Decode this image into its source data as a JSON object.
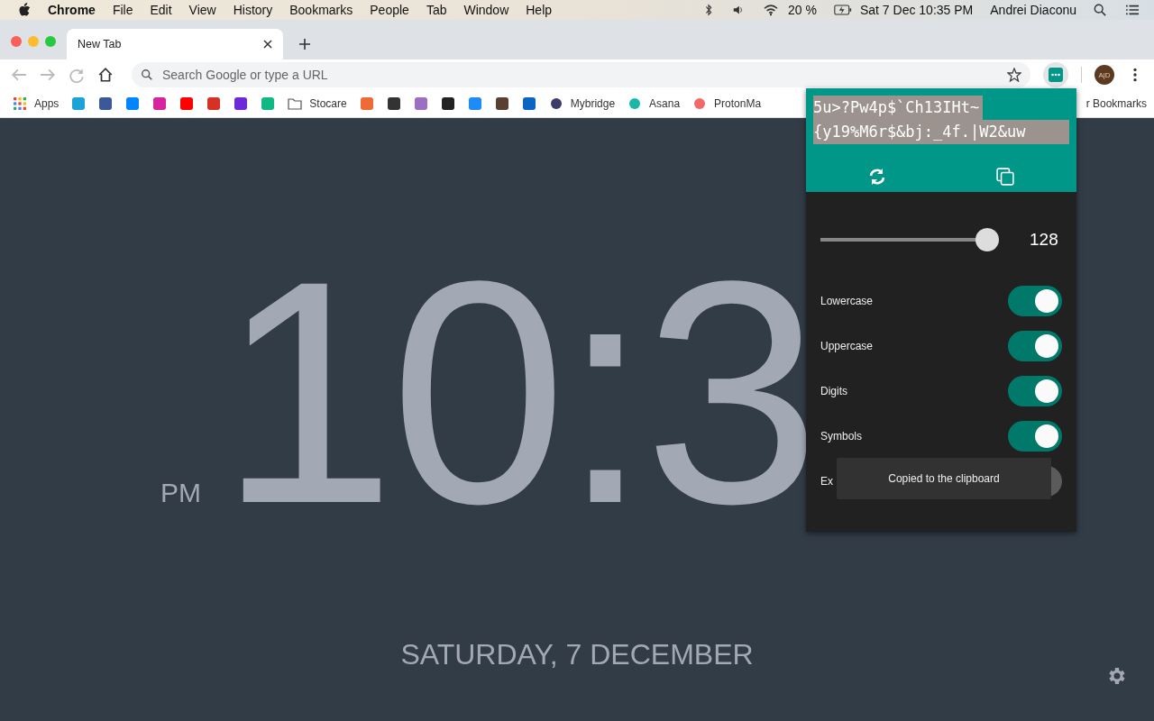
{
  "menubar": {
    "app": "Chrome",
    "items": [
      "File",
      "Edit",
      "View",
      "History",
      "Bookmarks",
      "People",
      "Tab",
      "Window",
      "Help"
    ],
    "battery": "20 %",
    "datetime": "Sat 7 Dec  10:35 PM",
    "user": "Andrei Diaconu"
  },
  "tabs": [
    {
      "title": "New Tab",
      "selected": true
    }
  ],
  "omnibox": {
    "placeholder": "Search Google or type a URL"
  },
  "profile": {
    "initials": "A|D"
  },
  "bookmarks": [
    {
      "kind": "apps",
      "label": "Apps"
    },
    {
      "kind": "icon"
    },
    {
      "kind": "icon"
    },
    {
      "kind": "icon"
    },
    {
      "kind": "icon"
    },
    {
      "kind": "icon"
    },
    {
      "kind": "icon"
    },
    {
      "kind": "icon"
    },
    {
      "kind": "icon"
    },
    {
      "kind": "folder",
      "label": "Stocare"
    },
    {
      "kind": "icon"
    },
    {
      "kind": "icon"
    },
    {
      "kind": "icon"
    },
    {
      "kind": "icon"
    },
    {
      "kind": "icon"
    },
    {
      "kind": "icon"
    },
    {
      "kind": "icon"
    },
    {
      "kind": "site",
      "label": "Mybridge"
    },
    {
      "kind": "site",
      "label": "Asana"
    },
    {
      "kind": "site",
      "label": "ProtonMa"
    }
  ],
  "other_bookmarks": "r Bookmarks",
  "clock": {
    "time": "10:3",
    "period": "PM",
    "date": "SATURDAY, 7 DECEMBER"
  },
  "popup": {
    "password_lines": [
      "5u>?Pw4p$`Ch13IHt~",
      "{y19%M6r$&bj:_4f.|W2&uw"
    ],
    "length": {
      "level": 0.95,
      "value": "128"
    },
    "options": [
      {
        "label": "Lowercase",
        "on": true
      },
      {
        "label": "Uppercase",
        "on": true
      },
      {
        "label": "Digits",
        "on": true
      },
      {
        "label": "Symbols",
        "on": true
      },
      {
        "label": "Ex",
        "on": false
      }
    ],
    "toast": "Copied to the clipboard"
  }
}
